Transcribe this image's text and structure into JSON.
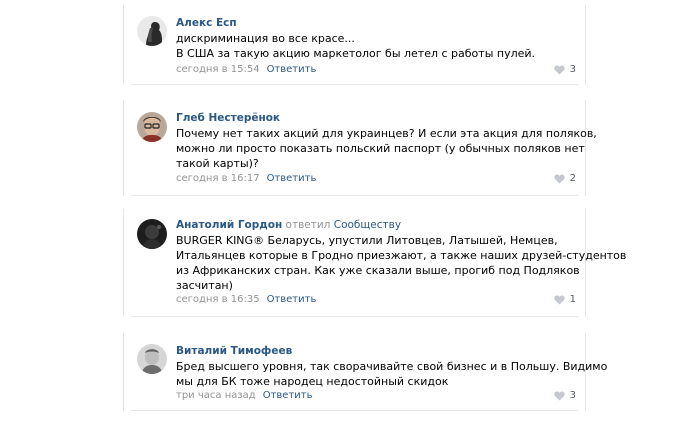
{
  "comments": [
    {
      "author": "Алекс Есп",
      "avatar_icon": "user-photo-icon",
      "lines": [
        "дискриминация во все красе...",
        "В США за такую акцию маркетолог бы летел с работы пулей."
      ],
      "time": "сегодня в 15:54",
      "reply_label": "Ответить",
      "likes": "3"
    },
    {
      "author": "Глеб Нестерёнок",
      "avatar_icon": "user-photo-icon",
      "lines": [
        "Почему нет таких акций для украинцев? И если эта акция для поляков,",
        "можно ли просто показать польский паспорт (у обычных поляков нет",
        "такой карты)?"
      ],
      "time": "сегодня в 16:17",
      "reply_label": "Ответить",
      "likes": "2"
    },
    {
      "author": "Анатолий Гордон",
      "replied_word": "ответил",
      "replied_to": "Сообществу",
      "avatar_icon": "user-photo-icon",
      "lines": [
        "BURGER KING® Беларусь, упустили Литовцев, Латышей, Немцев,",
        "Итальянцев которые в Гродно приезжают, а также наших друзей-студентов",
        "из Африканских стран. Как уже сказали выше, прогиб под Подляков",
        "засчитан)"
      ],
      "time": "сегодня в 16:35",
      "reply_label": "Ответить",
      "likes": "1"
    },
    {
      "author": "Виталий Тимофеев",
      "avatar_icon": "user-photo-icon",
      "lines": [
        "Бред высшего уровня, так сворачивайте свой бизнес и в Польшу. Видимо",
        "мы для БК тоже народец недостойный скидок"
      ],
      "time": "три часа назад",
      "reply_label": "Ответить",
      "likes": "3"
    }
  ],
  "colors": {
    "link": "#2a5885",
    "meta": "#939393",
    "text": "#000000",
    "like_icon": "#c5c9cf"
  }
}
